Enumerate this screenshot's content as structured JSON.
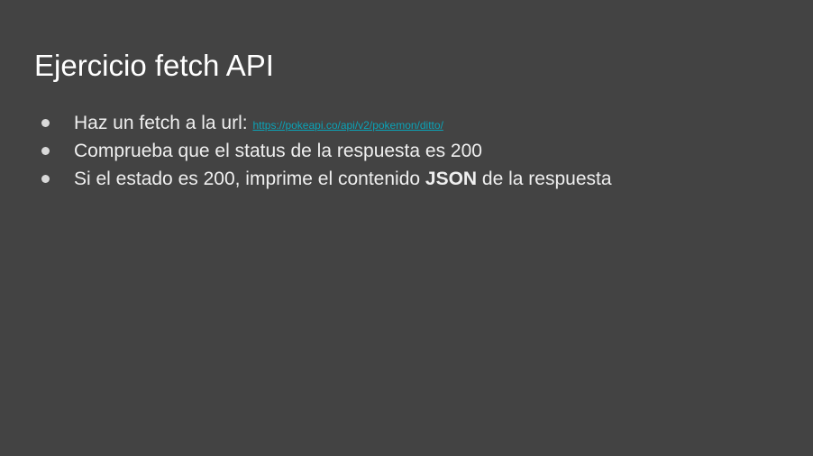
{
  "slide": {
    "title": "Ejercicio fetch API",
    "bullets": [
      {
        "text": "Haz un fetch a la url: ",
        "link": "https://pokeapi.co/api/v2/pokemon/ditto/"
      },
      {
        "text": "Comprueba que el status de la respuesta es 200"
      },
      {
        "before": "Si el estado es 200, imprime el contenido ",
        "bold": "JSON",
        "after": " de la respuesta"
      }
    ]
  },
  "colors": {
    "background": "#434343",
    "text": "#efefef",
    "link": "#0aa4b8",
    "bullet": "#d9d9d9"
  }
}
